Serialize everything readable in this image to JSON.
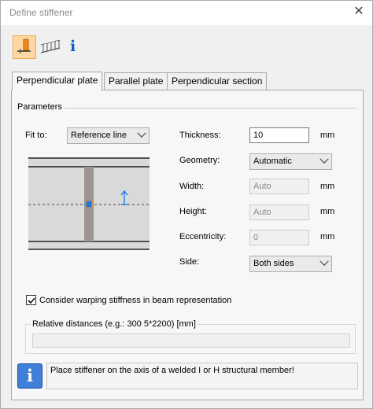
{
  "window": {
    "title": "Define stiffener",
    "close_glyph": "✕"
  },
  "toolbar": {
    "buttons": [
      {
        "icon": "perpendicular-stiffener-icon",
        "active": true
      },
      {
        "icon": "stiffener-series-icon",
        "active": false
      },
      {
        "icon": "info-icon",
        "glyph": "i",
        "active": false
      }
    ]
  },
  "tabs": [
    {
      "label": "Perpendicular plate",
      "active": true
    },
    {
      "label": "Parallel plate",
      "active": false
    },
    {
      "label": "Perpendicular section",
      "active": false
    }
  ],
  "parameters": {
    "group_label": "Parameters",
    "fit_to": {
      "label": "Fit to:",
      "value": "Reference line"
    },
    "thickness": {
      "label": "Thickness:",
      "value": "10",
      "unit": "mm"
    },
    "geometry": {
      "label": "Geometry:",
      "value": "Automatic"
    },
    "width": {
      "label": "Width:",
      "value": "Auto",
      "unit": "mm"
    },
    "height": {
      "label": "Height:",
      "value": "Auto",
      "unit": "mm"
    },
    "eccentricity": {
      "label": "Eccentricity:",
      "value": "0",
      "unit": "mm"
    },
    "side": {
      "label": "Side:",
      "value": "Both sides"
    }
  },
  "warping": {
    "label": "Consider warping stiffness in beam representation",
    "checked": true
  },
  "relative_distances": {
    "legend": "Relative distances (e.g.: 300 5*2200) [mm]",
    "value": ""
  },
  "message": {
    "icon_glyph": "i",
    "text": "Place stiffener on the axis of a welded I or H structural member!"
  },
  "colors": {
    "accent": "#1e78e6",
    "stiffener_plate": "#9c9594",
    "active_button_bg": "#ffd7a3"
  }
}
